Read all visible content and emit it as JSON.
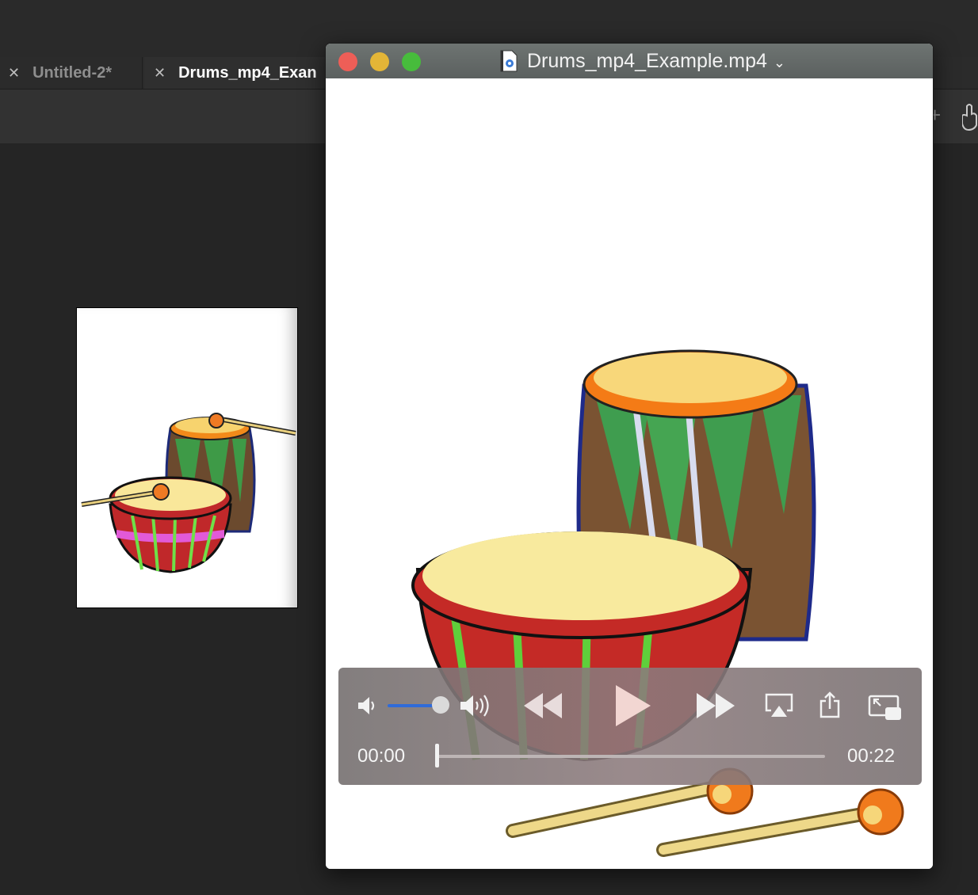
{
  "tabs": [
    {
      "label": "Untitled-2*",
      "active": false
    },
    {
      "label": "Drums_mp4_Exan",
      "active": true
    }
  ],
  "player": {
    "title": "Drums_mp4_Example.mp4",
    "current_time": "00:00",
    "duration": "00:22",
    "progress": 0.0,
    "volume": 0.8,
    "accent_color": "#2f6bd9"
  },
  "icons": {
    "traffic_lights": [
      "close-icon",
      "minimize-icon",
      "zoom-icon"
    ],
    "controls": [
      "volume-low-icon",
      "volume-high-icon",
      "rewind-icon",
      "play-icon",
      "fast-forward-icon",
      "airplay-icon",
      "share-icon",
      "picture-in-picture-icon"
    ]
  }
}
